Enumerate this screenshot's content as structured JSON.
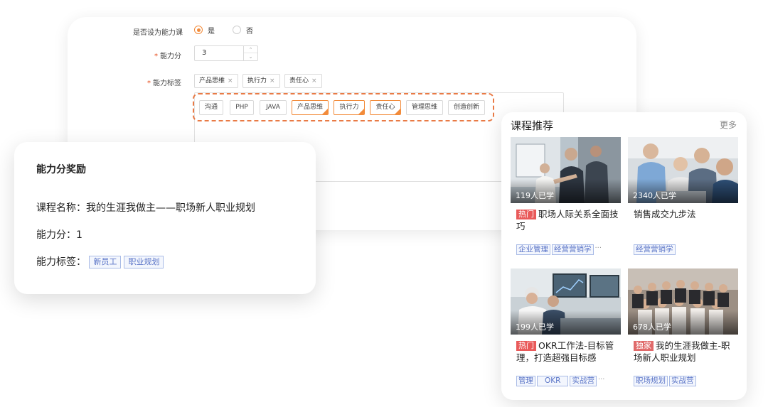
{
  "form": {
    "capability_course_label": "是否设为能力课",
    "option_yes": "是",
    "option_no": "否",
    "score_label": "能力分",
    "score_value": "3",
    "tags_label": "能力标签",
    "selected_tags": [
      "产品思维",
      "执行力",
      "责任心"
    ],
    "tag_options": [
      {
        "label": "沟通",
        "selected": false
      },
      {
        "label": "PHP",
        "selected": false
      },
      {
        "label": "JAVA",
        "selected": false
      },
      {
        "label": "产品思维",
        "selected": true
      },
      {
        "label": "执行力",
        "selected": true
      },
      {
        "label": "责任心",
        "selected": true
      },
      {
        "label": "管理思维",
        "selected": false
      },
      {
        "label": "创造创新",
        "selected": false
      }
    ],
    "accent_color": "#f28b3a"
  },
  "reward": {
    "title": "能力分奖励",
    "course_name_label": "课程名称：",
    "course_name": "我的生涯我做主——职场新人职业规划",
    "score_label": "能力分：",
    "score": "1",
    "tags_label": "能力标签：",
    "tags": [
      "新员工",
      "职业规划"
    ]
  },
  "recommend": {
    "title": "课程推荐",
    "more": "更多",
    "courses": [
      {
        "learners": "119人已学",
        "badge": "热门",
        "title": "职场人际关系全面技巧",
        "tags": [
          "企业管理",
          "经营营销学"
        ],
        "more": "···"
      },
      {
        "learners": "2340人已学",
        "badge": "",
        "title": "销售成交九步法",
        "tags": [
          "经营营销学"
        ],
        "more": ""
      },
      {
        "learners": "199人已学",
        "badge": "热门",
        "title": "OKR工作法-目标管理，打造超强目标感",
        "tags": [
          "管理",
          "OKR",
          "实战营"
        ],
        "more": "···"
      },
      {
        "learners": "678人已学",
        "badge": "独家",
        "title": "我的生涯我做主-职场新人职业规划",
        "tags": [
          "职场规划",
          "实战营"
        ],
        "more": ""
      }
    ]
  }
}
